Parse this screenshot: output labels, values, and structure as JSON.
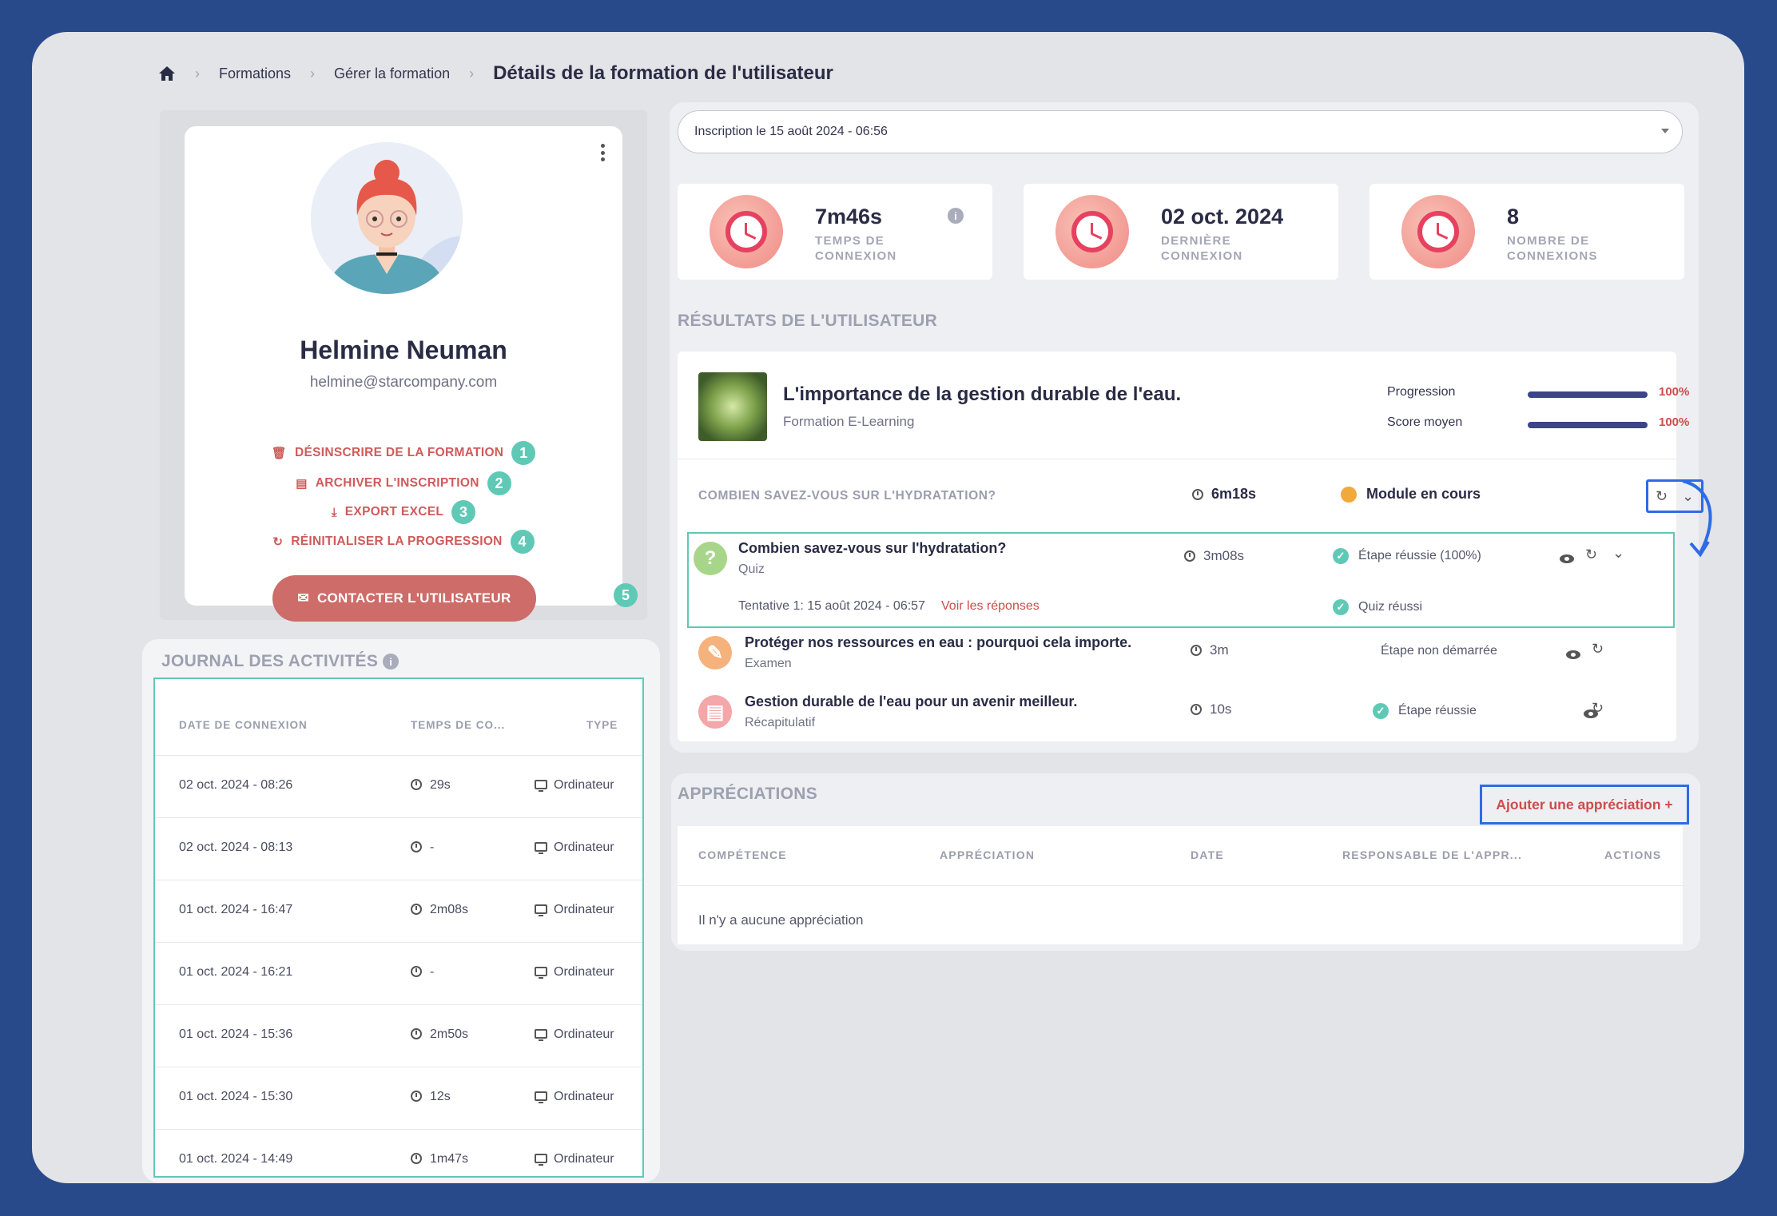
{
  "breadcrumb": {
    "item1": "Formations",
    "item2": "Gérer la formation",
    "current": "Détails de la formation de l'utilisateur"
  },
  "profile": {
    "name": "Helmine Neuman",
    "email": "helmine@starcompany.com",
    "actions": [
      {
        "label": "DÉSINSCRIRE DE LA FORMATION",
        "num": "1"
      },
      {
        "label": "ARCHIVER L'INSCRIPTION",
        "num": "2"
      },
      {
        "label": "EXPORT EXCEL",
        "num": "3"
      },
      {
        "label": "RÉINITIALISER LA PROGRESSION",
        "num": "4"
      }
    ],
    "contact_label": "CONTACTER L'UTILISATEUR",
    "contact_num": "5"
  },
  "journal": {
    "title": "JOURNAL DES ACTIVITÉS",
    "headers": {
      "date": "DATE DE CONNEXION",
      "time": "TEMPS DE CO...",
      "type": "TYPE"
    },
    "rows": [
      {
        "date": "02 oct. 2024 - 08:26",
        "time": "29s",
        "type": "Ordinateur"
      },
      {
        "date": "02 oct. 2024 - 08:13",
        "time": "-",
        "type": "Ordinateur"
      },
      {
        "date": "01 oct. 2024 - 16:47",
        "time": "2m08s",
        "type": "Ordinateur"
      },
      {
        "date": "01 oct. 2024 - 16:21",
        "time": "-",
        "type": "Ordinateur"
      },
      {
        "date": "01 oct. 2024 - 15:36",
        "time": "2m50s",
        "type": "Ordinateur"
      },
      {
        "date": "01 oct. 2024 - 15:30",
        "time": "12s",
        "type": "Ordinateur"
      },
      {
        "date": "01 oct. 2024 - 14:49",
        "time": "1m47s",
        "type": "Ordinateur"
      }
    ]
  },
  "enrollment_select": "Inscription le 15 août 2024 - 06:56",
  "stats": [
    {
      "value": "7m46s",
      "label": "TEMPS DE CONNEXION"
    },
    {
      "value": "02 oct. 2024",
      "label": "DERNIÈRE CONNEXION"
    },
    {
      "value": "8",
      "label": "NOMBRE DE CONNEXIONS"
    }
  ],
  "results": {
    "title": "RÉSULTATS DE L'UTILISATEUR",
    "course_title": "L'importance de la gestion durable de l'eau.",
    "course_type": "Formation E-Learning",
    "progress_label": "Progression",
    "progress_value": "100%",
    "score_label": "Score moyen",
    "score_value": "100%",
    "module": {
      "title": "COMBIEN SAVEZ-VOUS SUR L'HYDRATATION?",
      "time": "6m18s",
      "status": "Module en cours"
    },
    "steps": [
      {
        "title": "Combien savez-vous sur l'hydratation?",
        "type": "Quiz",
        "time": "3m08s",
        "status": "Étape réussie (100%)",
        "attempt": "Tentative 1: 15 août 2024 - 06:57",
        "link": "Voir les réponses",
        "quiz_status": "Quiz réussi"
      },
      {
        "title": "Protéger nos ressources en eau : pourquoi cela importe.",
        "type": "Examen",
        "time": "3m",
        "status": "Étape non démarrée"
      },
      {
        "title": "Gestion durable de l'eau pour un avenir meilleur.",
        "type": "Récapitulatif",
        "time": "10s",
        "status": "Étape réussie"
      }
    ]
  },
  "appreciations": {
    "title": "APPRÉCIATIONS",
    "add_label": "Ajouter une appréciation +",
    "headers": [
      "COMPÉTENCE",
      "APPRÉCIATION",
      "DATE",
      "RESPONSABLE DE L'APPR...",
      "ACTIONS"
    ],
    "empty": "Il n'y a aucune appréciation"
  },
  "colors": {
    "accent": "#5fc9b6",
    "danger": "#d05a5a",
    "highlight": "#2e6be6",
    "bar": "#3c4587",
    "bg": "#28498a"
  }
}
